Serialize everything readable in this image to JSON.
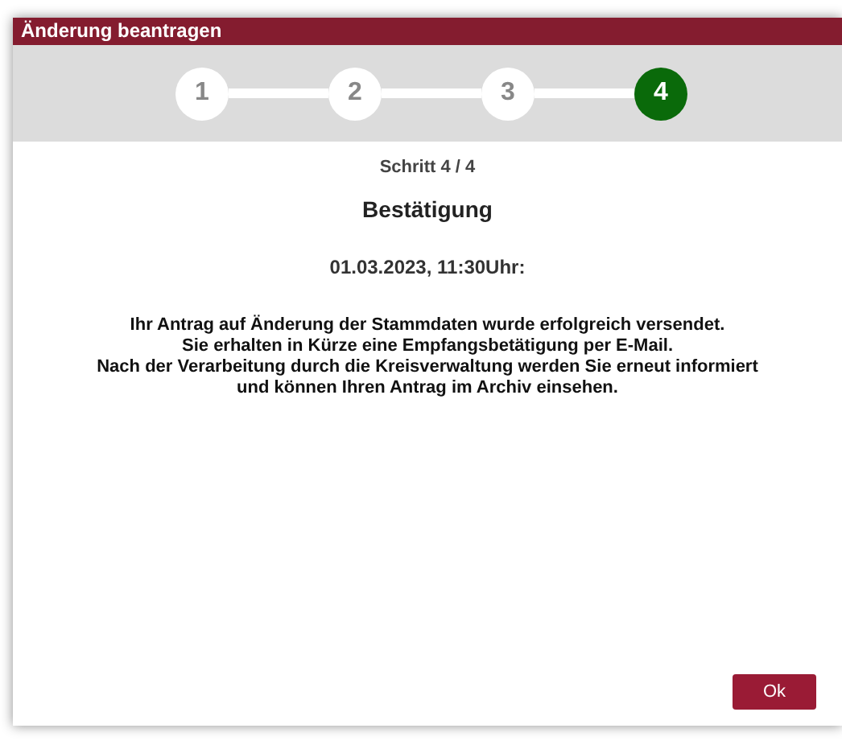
{
  "window": {
    "title": "Änderung beantragen"
  },
  "steps": [
    {
      "label": "1",
      "selected": false
    },
    {
      "label": "2",
      "selected": false
    },
    {
      "label": "3",
      "selected": false
    },
    {
      "label": "4",
      "selected": true
    }
  ],
  "step_counter": "Schritt 4 / 4",
  "heading": "Bestätigung",
  "timestamp": "01.03.2023, 11:30Uhr:",
  "message_lines": [
    "Ihr Antrag auf Änderung der Stammdaten wurde erfolgreich versendet.",
    "Sie erhalten in Kürze eine Empfangsbetätigung per E-Mail.",
    "Nach der Verarbeitung durch die Kreisverwaltung werden Sie erneut informiert",
    "und können Ihren Antrag im Archiv einsehen."
  ],
  "buttons": [
    "Ok"
  ]
}
